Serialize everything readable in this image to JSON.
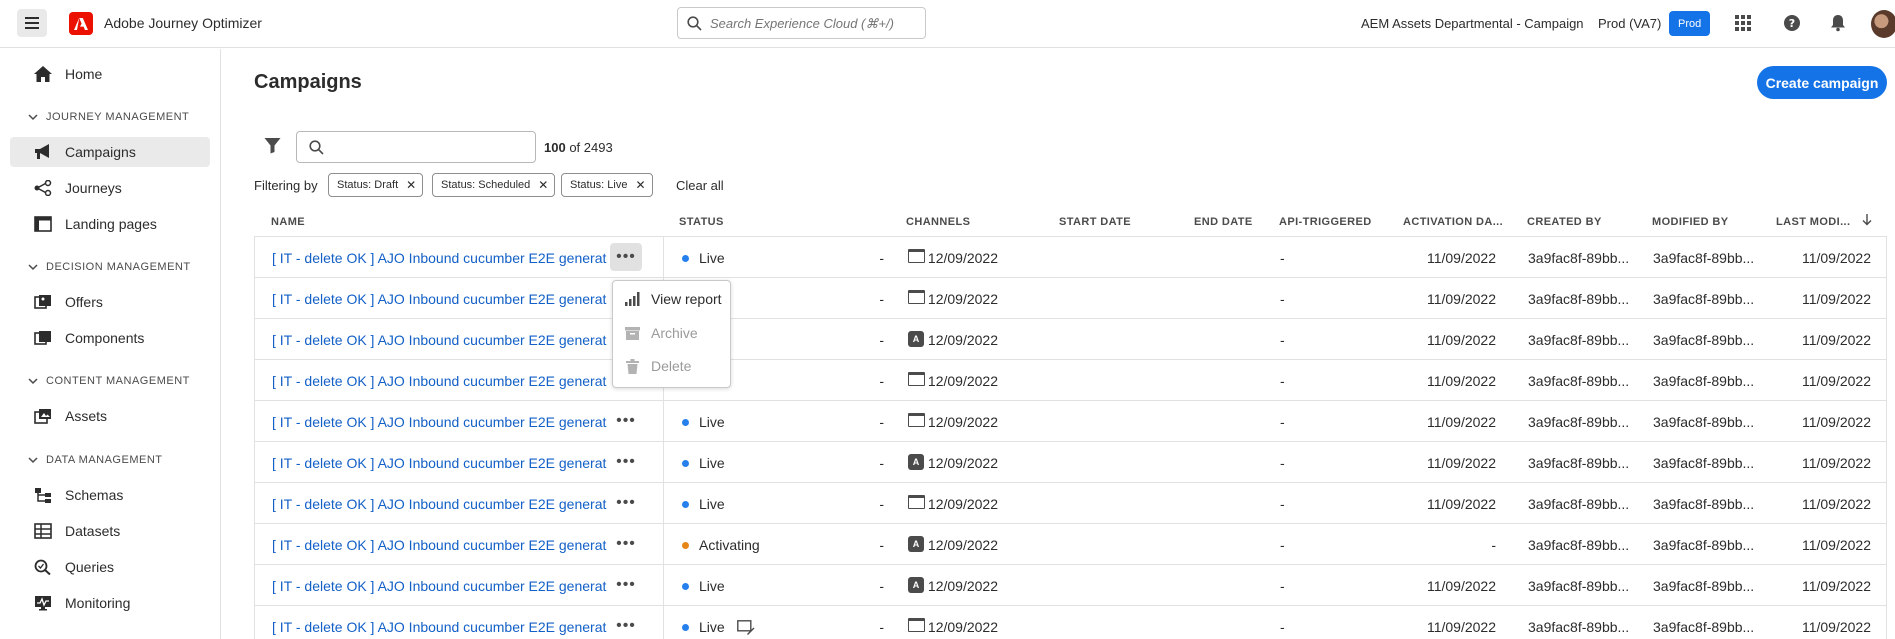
{
  "header": {
    "app_title": "Adobe Journey Optimizer",
    "search_placeholder": "Search Experience Cloud (⌘+/)",
    "org_name": "AEM Assets Departmental - Campaign",
    "sandbox_label": "Prod (VA7)",
    "env_badge": "Prod",
    "icons": [
      "menu-icon",
      "adobe-logo",
      "search-icon",
      "apps-grid-icon",
      "help-icon",
      "bell-icon",
      "avatar"
    ],
    "accent_color": "#1473e6",
    "brand_color": "#eb1000"
  },
  "sidebar": {
    "home": "Home",
    "sections": [
      {
        "title": "JOURNEY MANAGEMENT",
        "items": [
          "Campaigns",
          "Journeys",
          "Landing pages"
        ]
      },
      {
        "title": "DECISION MANAGEMENT",
        "items": [
          "Offers",
          "Components"
        ]
      },
      {
        "title": "CONTENT MANAGEMENT",
        "items": [
          "Assets"
        ]
      },
      {
        "title": "DATA MANAGEMENT",
        "items": [
          "Schemas",
          "Datasets",
          "Queries",
          "Monitoring"
        ]
      }
    ],
    "active_item": "Campaigns"
  },
  "main": {
    "title": "Campaigns",
    "create_button": "Create campaign",
    "count_shown": "100",
    "count_total": "of 2493",
    "filtering_label": "Filtering by",
    "filters": [
      "Status: Draft",
      "Status: Scheduled",
      "Status: Live"
    ],
    "clear_all": "Clear all"
  },
  "table": {
    "columns": [
      "NAME",
      "STATUS",
      "CHANNELS",
      "START DATE",
      "END DATE",
      "API-TRIGGERED",
      "ACTIVATION DA...",
      "CREATED BY",
      "MODIFIED BY",
      "LAST MODI..."
    ],
    "sort_icon": "arrow-down-icon",
    "rows": [
      {
        "name": "[ IT - delete OK ] AJO Inbound cucumber E2E generat",
        "status": "Live",
        "status_color": "#2680eb",
        "channel": "web",
        "start": "-",
        "end": "12/09/2022",
        "api": "-",
        "activation": "11/09/2022",
        "created_by": "3a9fac8f-89bb...",
        "modified_by": "3a9fac8f-89bb...",
        "last_modified": "11/09/2022"
      },
      {
        "name": "[ IT - delete OK ] AJO Inbound cucumber E2E generat",
        "status": "",
        "status_color": "",
        "channel": "web",
        "start": "-",
        "end": "12/09/2022",
        "api": "-",
        "activation": "11/09/2022",
        "created_by": "3a9fac8f-89bb...",
        "modified_by": "3a9fac8f-89bb...",
        "last_modified": "11/09/2022"
      },
      {
        "name": "[ IT - delete OK ] AJO Inbound cucumber E2E generat",
        "status": "",
        "status_color": "",
        "channel": "app",
        "start": "-",
        "end": "12/09/2022",
        "api": "-",
        "activation": "11/09/2022",
        "created_by": "3a9fac8f-89bb...",
        "modified_by": "3a9fac8f-89bb...",
        "last_modified": "11/09/2022"
      },
      {
        "name": "[ IT - delete OK ] AJO Inbound cucumber E2E generat",
        "status": "",
        "status_color": "",
        "channel": "web",
        "start": "-",
        "end": "12/09/2022",
        "api": "-",
        "activation": "11/09/2022",
        "created_by": "3a9fac8f-89bb...",
        "modified_by": "3a9fac8f-89bb...",
        "last_modified": "11/09/2022"
      },
      {
        "name": "[ IT - delete OK ] AJO Inbound cucumber E2E generat",
        "status": "Live",
        "status_color": "#2680eb",
        "channel": "web",
        "start": "-",
        "end": "12/09/2022",
        "api": "-",
        "activation": "11/09/2022",
        "created_by": "3a9fac8f-89bb...",
        "modified_by": "3a9fac8f-89bb...",
        "last_modified": "11/09/2022"
      },
      {
        "name": "[ IT - delete OK ] AJO Inbound cucumber E2E generat",
        "status": "Live",
        "status_color": "#2680eb",
        "channel": "app",
        "start": "-",
        "end": "12/09/2022",
        "api": "-",
        "activation": "11/09/2022",
        "created_by": "3a9fac8f-89bb...",
        "modified_by": "3a9fac8f-89bb...",
        "last_modified": "11/09/2022"
      },
      {
        "name": "[ IT - delete OK ] AJO Inbound cucumber E2E generat",
        "status": "Live",
        "status_color": "#2680eb",
        "channel": "web",
        "start": "-",
        "end": "12/09/2022",
        "api": "-",
        "activation": "11/09/2022",
        "created_by": "3a9fac8f-89bb...",
        "modified_by": "3a9fac8f-89bb...",
        "last_modified": "11/09/2022"
      },
      {
        "name": "[ IT - delete OK ] AJO Inbound cucumber E2E generat",
        "status": "Activating",
        "status_color": "#e68619",
        "channel": "app",
        "start": "-",
        "end": "12/09/2022",
        "api": "-",
        "activation": "-",
        "created_by": "3a9fac8f-89bb...",
        "modified_by": "3a9fac8f-89bb...",
        "last_modified": "11/09/2022"
      },
      {
        "name": "[ IT - delete OK ] AJO Inbound cucumber E2E generat",
        "status": "Live",
        "status_color": "#2680eb",
        "channel": "app",
        "start": "-",
        "end": "12/09/2022",
        "api": "-",
        "activation": "11/09/2022",
        "created_by": "3a9fac8f-89bb...",
        "modified_by": "3a9fac8f-89bb...",
        "last_modified": "11/09/2022"
      },
      {
        "name": "[ IT - delete OK ] AJO Inbound cucumber E2E generat",
        "status": "Live",
        "status_color": "#2680eb",
        "channel": "web",
        "start": "-",
        "end": "12/09/2022",
        "api": "-",
        "activation": "11/09/2022",
        "created_by": "3a9fac8f-89bb...",
        "modified_by": "3a9fac8f-89bb...",
        "last_modified": "11/09/2022",
        "has_edit_icon": true
      }
    ]
  },
  "row_menu": {
    "items": [
      {
        "label": "View report",
        "icon": "chart-icon",
        "disabled": false
      },
      {
        "label": "Archive",
        "icon": "archive-icon",
        "disabled": true
      },
      {
        "label": "Delete",
        "icon": "trash-icon",
        "disabled": true
      }
    ]
  }
}
